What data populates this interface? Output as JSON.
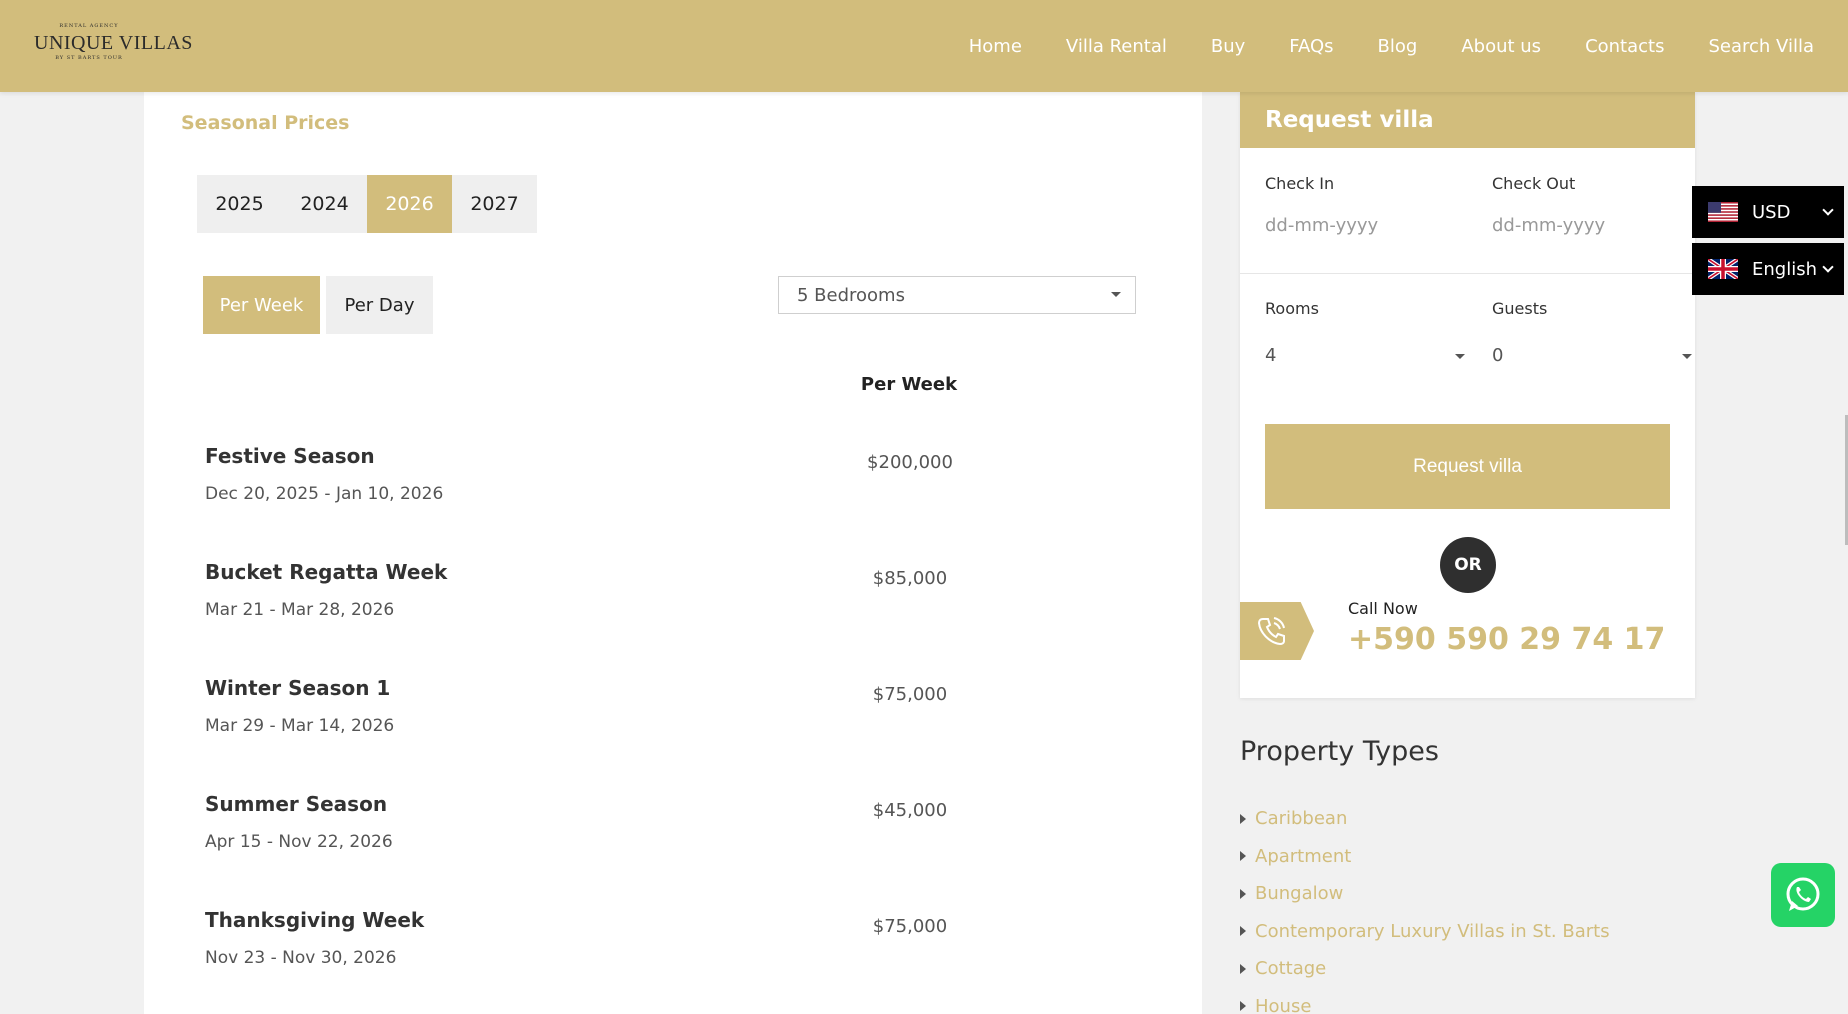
{
  "header": {
    "logo": {
      "top": "RENTAL AGENCY",
      "main": "UNIQUE VILLAS",
      "sub": "BY ST BARTS TOUR"
    },
    "nav": [
      "Home",
      "Villa Rental",
      "Buy",
      "FAQs",
      "Blog",
      "About us",
      "Contacts",
      "Search Villa"
    ]
  },
  "prices": {
    "title": "Seasonal Prices",
    "years": [
      {
        "label": "2025",
        "active": false
      },
      {
        "label": "2024",
        "active": false
      },
      {
        "label": "2026",
        "active": true
      },
      {
        "label": "2027",
        "active": false
      }
    ],
    "period_tabs": {
      "week": "Per Week",
      "day": "Per Day"
    },
    "bedrooms": "5 Bedrooms",
    "column_header": "Per Week",
    "seasons": [
      {
        "name": "Festive Season",
        "dates": "Dec 20, 2025 - Jan 10, 2026",
        "price": "$200,000"
      },
      {
        "name": "Bucket Regatta Week",
        "dates": "Mar 21 - Mar 28, 2026",
        "price": "$85,000"
      },
      {
        "name": "Winter Season 1",
        "dates": "Mar 29 - Mar 14, 2026",
        "price": "$75,000"
      },
      {
        "name": "Summer Season",
        "dates": "Apr 15 - Nov 22, 2026",
        "price": "$45,000"
      },
      {
        "name": "Thanksgiving Week",
        "dates": "Nov 23 - Nov 30, 2026",
        "price": "$75,000"
      }
    ]
  },
  "request": {
    "title": "Request villa",
    "check_in_label": "Check In",
    "check_in_placeholder": "dd-mm-yyyy",
    "check_out_label": "Check Out",
    "check_out_placeholder": "dd-mm-yyyy",
    "rooms_label": "Rooms",
    "rooms_value": "4",
    "guests_label": "Guests",
    "guests_value": "0",
    "button": "Request villa",
    "or": "OR",
    "call_label": "Call Now",
    "phone": "+590 590 29 74 17"
  },
  "property_types": {
    "title": "Property Types",
    "items": [
      "Caribbean",
      "Apartment",
      "Bungalow",
      "Contemporary Luxury Villas in St. Barts",
      "Cottage",
      "House"
    ]
  },
  "floating": {
    "currency": "USD",
    "language": "English"
  },
  "colors": {
    "accent": "#d2bd7c",
    "dark": "#000000",
    "whatsapp": "#25d366"
  }
}
